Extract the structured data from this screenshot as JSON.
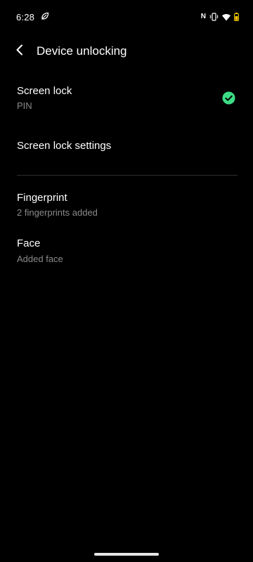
{
  "status_bar": {
    "time": "6:28",
    "left_icon": "leaf-icon",
    "right_icons": [
      "nfc-icon",
      "vibrate-icon",
      "wifi-icon",
      "battery-icon"
    ],
    "nfc_label": "N",
    "battery_color": "#f2c200"
  },
  "header": {
    "title": "Device unlocking",
    "back_icon": "back-arrow-icon"
  },
  "items": {
    "screen_lock": {
      "title": "Screen lock",
      "subtitle": "PIN",
      "status_icon": "check-circle-icon",
      "status_color": "#3ddc84"
    },
    "screen_lock_settings": {
      "title": "Screen lock settings"
    },
    "fingerprint": {
      "title": "Fingerprint",
      "subtitle": "2 fingerprints added"
    },
    "face": {
      "title": "Face",
      "subtitle": "Added face"
    }
  },
  "colors": {
    "background": "#000000",
    "text_primary": "#ffffff",
    "text_secondary": "#8a8a8a",
    "accent": "#3ddc84"
  }
}
